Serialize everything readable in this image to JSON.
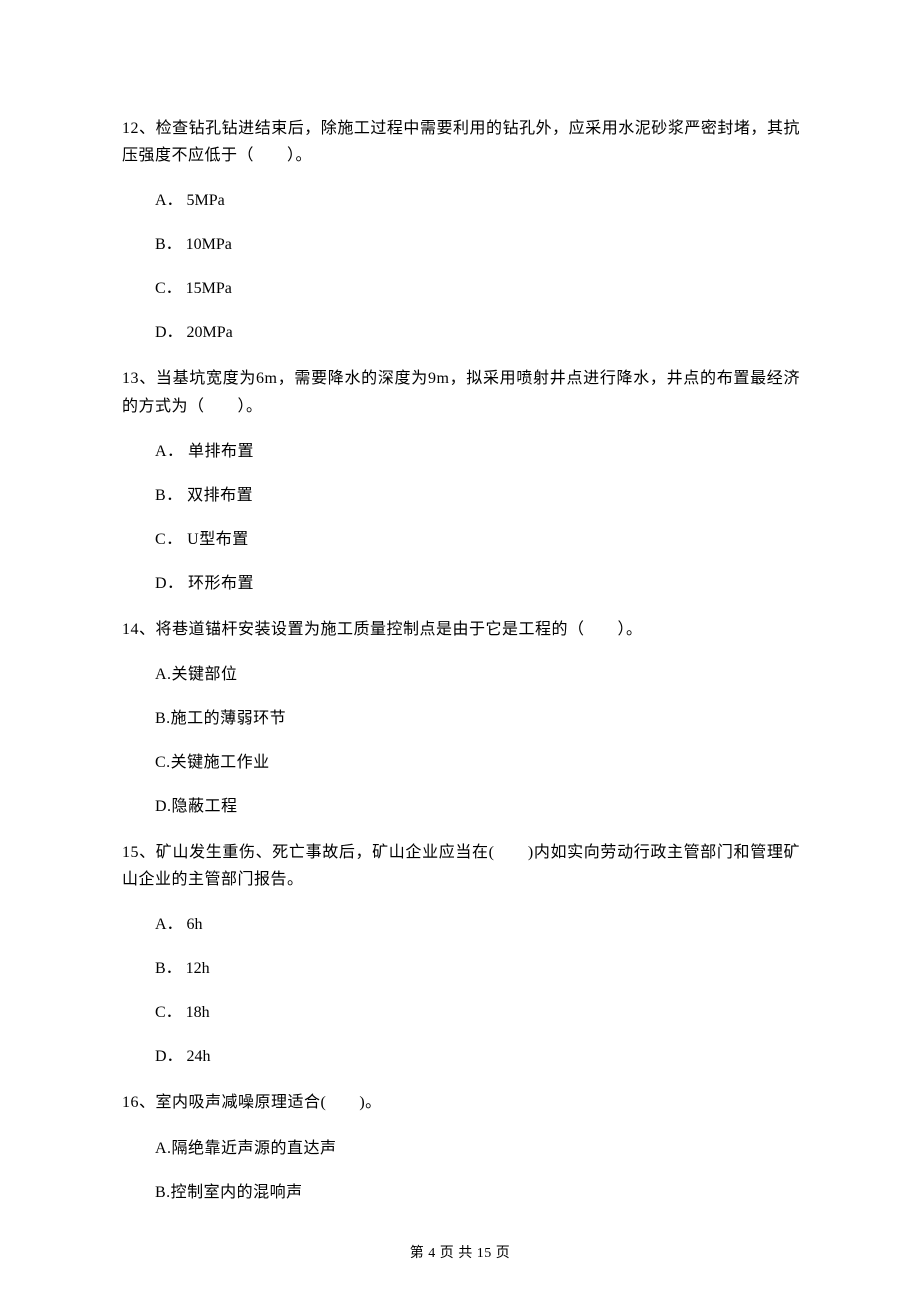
{
  "questions": [
    {
      "num": "12、",
      "text": "检查钻孔钻进结束后，除施工过程中需要利用的钻孔外，应采用水泥砂浆严密封堵，其抗压强度不应低于（　　）。",
      "options": [
        "A． 5MPa",
        "B． 10MPa",
        "C． 15MPa",
        "D． 20MPa"
      ]
    },
    {
      "num": "13、",
      "text": "当基坑宽度为6m，需要降水的深度为9m，拟采用喷射井点进行降水，井点的布置最经济的方式为（　　）。",
      "options": [
        "A． 单排布置",
        "B． 双排布置",
        "C． U型布置",
        "D． 环形布置"
      ]
    },
    {
      "num": "14、",
      "text": "将巷道锚杆安装设置为施工质量控制点是由于它是工程的（　　）。",
      "options": [
        "A.关键部位",
        "B.施工的薄弱环节",
        "C.关键施工作业",
        "D.隐蔽工程"
      ]
    },
    {
      "num": "15、",
      "text": "矿山发生重伤、死亡事故后，矿山企业应当在(　　)内如实向劳动行政主管部门和管理矿山企业的主管部门报告。",
      "options": [
        "A． 6h",
        "B． 12h",
        "C． 18h",
        "D． 24h"
      ]
    },
    {
      "num": "16、",
      "text": "室内吸声减噪原理适合(　　)。",
      "options": [
        "A.隔绝靠近声源的直达声",
        "B.控制室内的混响声"
      ]
    }
  ],
  "footer": "第 4 页 共 15 页"
}
